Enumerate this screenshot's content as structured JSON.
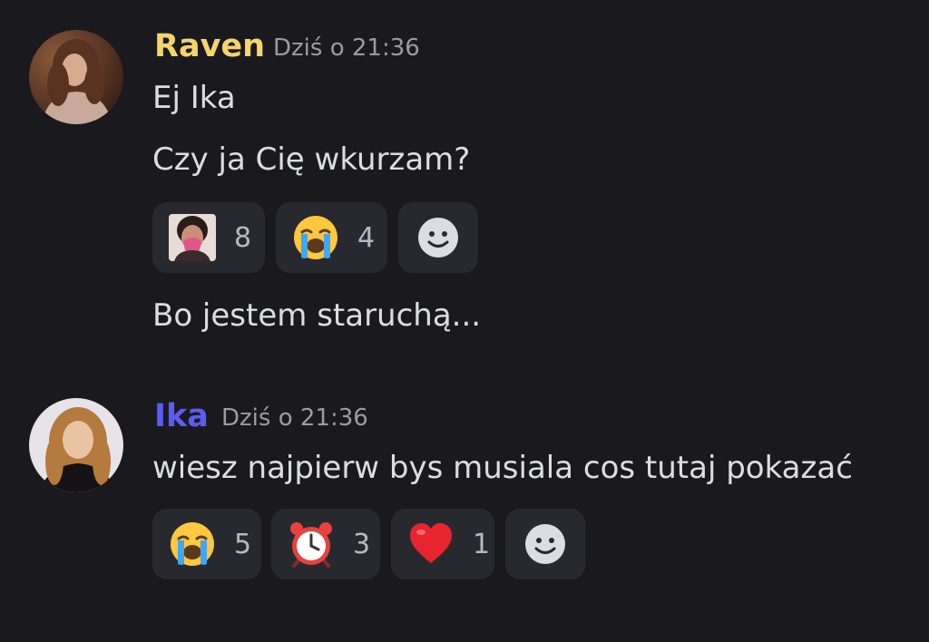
{
  "messages": [
    {
      "author": "Raven",
      "author_color": "#f5d56a",
      "timestamp": "Dziś o 21:36",
      "lines": [
        "Ej Ika",
        "Czy ja Cię wkurzam?",
        "Bo jestem staruchą..."
      ],
      "reactions": [
        {
          "icon": "crying-person-sticker",
          "count": "8"
        },
        {
          "icon": "loudly-crying-face",
          "count": "4"
        }
      ]
    },
    {
      "author": "Ika",
      "author_color": "#5b5cf6",
      "timestamp": "Dziś o 21:36",
      "lines": [
        "wiesz najpierw bys musiala cos tutaj pokazać"
      ],
      "reactions": [
        {
          "icon": "loudly-crying-face",
          "count": "5"
        },
        {
          "icon": "alarm-clock",
          "count": "3"
        },
        {
          "icon": "red-heart",
          "count": "1"
        }
      ]
    }
  ],
  "colors": {
    "background": "#1a1a1e",
    "reaction_bg": "#28292f",
    "text": "#dcdde2",
    "muted": "#9a9ba3"
  },
  "icons": {
    "add_reaction": "smiley-face-add-reaction-icon"
  }
}
